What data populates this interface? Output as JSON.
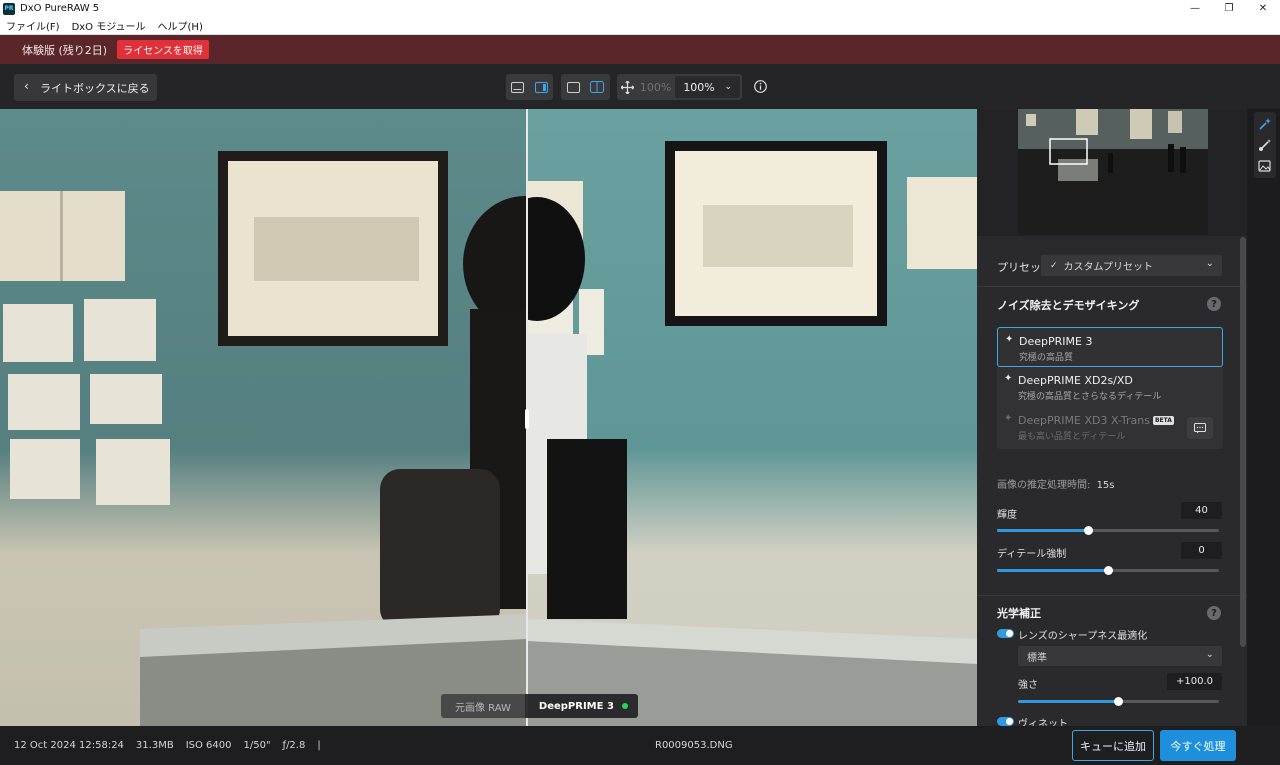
{
  "window": {
    "title": "DxO PureRAW 5",
    "app_icon_text": "PR",
    "minimize": "—",
    "maximize": "❐",
    "close": "✕"
  },
  "menu": {
    "items": [
      "ファイル(F)",
      "DxO モジュール",
      "ヘルプ(H)"
    ]
  },
  "trial": {
    "text": "体験版 (残り2日)",
    "license_button": "ライセンスを取得"
  },
  "toolbar": {
    "back_label": "ライトボックスに戻る",
    "zoom_percent_dim": "100%",
    "zoom_value": "100%"
  },
  "viewer": {
    "original_label": "元画像 RAW",
    "processed_label": "DeepPRIME 3"
  },
  "panel": {
    "preset_label": "プリセット",
    "preset_value": "カスタムプリセット",
    "noise_section_title": "ノイズ除去とデモザイキング",
    "engines": [
      {
        "name": "DeepPRIME 3",
        "subtitle": "究極の高品質",
        "state": "selected"
      },
      {
        "name": "DeepPRIME XD2s/XD",
        "subtitle": "究極の高品質とさらなるディテール",
        "state": "normal"
      },
      {
        "name": "DeepPRIME XD3 X-Trans",
        "subtitle": "最も高い品質とディテール",
        "state": "disabled",
        "badge": "BETA"
      }
    ],
    "estimate_label": "画像の推定処理時間:",
    "estimate_value": "15s",
    "luminance": {
      "label": "輝度",
      "value": "40",
      "fraction": 0.41
    },
    "detail": {
      "label": "ディテール強制",
      "value": "0",
      "fraction": 0.5
    },
    "optics_section_title": "光学補正",
    "lens_sharpness": {
      "label": "レンズのシャープネス最適化",
      "mode": "標準",
      "strength_label": "強さ",
      "strength_value": "+100.0",
      "fraction": 0.5
    },
    "vignette_label": "ヴィネット"
  },
  "status": {
    "date": "12 Oct 2024 12:58:24",
    "size": "31.3MB",
    "iso": "ISO 6400",
    "shutter": "1/50\"",
    "aperture": "ƒ/2.8",
    "separator": "|",
    "filename": "R0009053.DNG",
    "queue_button": "キューに追加",
    "process_button": "今すぐ処理"
  }
}
